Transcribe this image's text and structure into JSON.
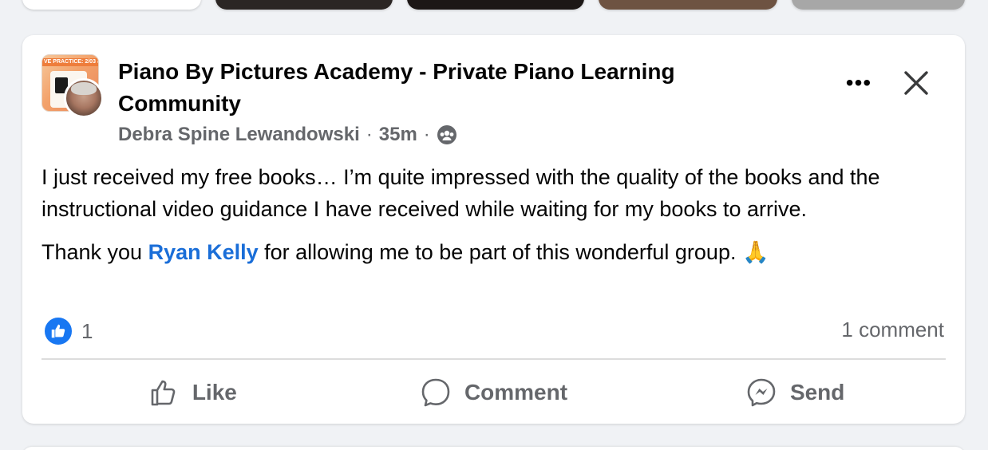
{
  "post": {
    "group_name": "Piano By Pictures Academy - Private Piano Learning Community",
    "group_avatar_banner": "VE PRACTICE: 2/03 &",
    "author": "Debra Spine Lewandowski",
    "separator": "·",
    "time": "35m",
    "privacy_icon": "group-members-icon",
    "body_p1": "I just received my free books… I’m quite impressed with the quality of the books and the instructional video guidance I have received while waiting for my books to arrive.",
    "body_p2_before": "Thank you ",
    "mention": "Ryan Kelly",
    "body_p2_after": " for allowing me to be part of this wonderful group. 🙏",
    "reaction_count": "1",
    "comment_count": "1 comment",
    "more_icon": "•••"
  },
  "actions": {
    "like": "Like",
    "comment": "Comment",
    "send": "Send"
  },
  "colors": {
    "accent": "#1877f2",
    "mention": "#1a6ed8",
    "muted": "#65676b",
    "background": "#f0f2f5"
  }
}
